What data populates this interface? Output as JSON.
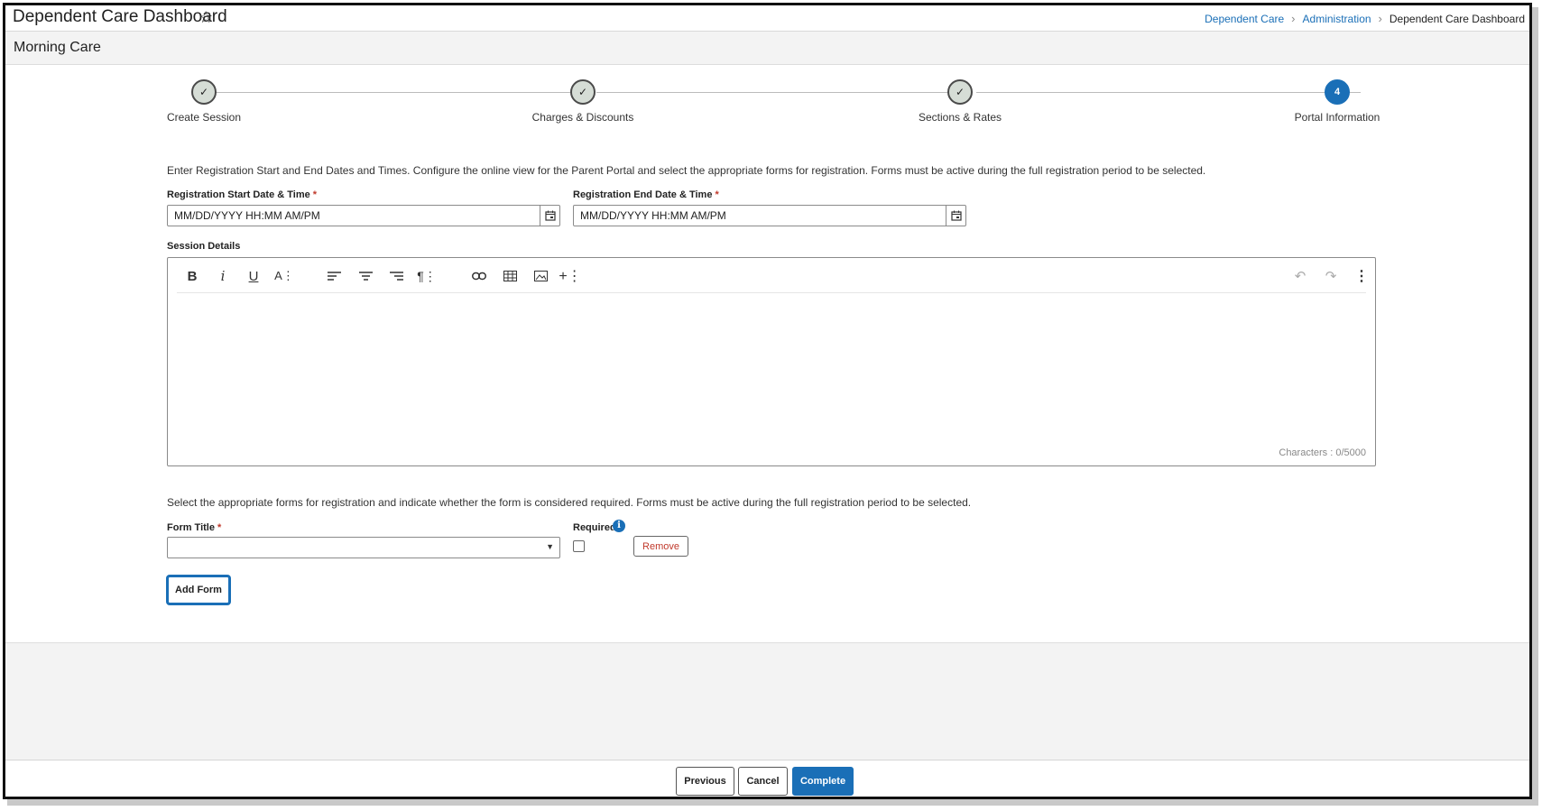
{
  "header": {
    "title": "Dependent Care Dashboard",
    "breadcrumb": [
      "Dependent Care",
      "Administration",
      "Dependent Care Dashboard"
    ]
  },
  "subheader": {
    "title": "Morning Care"
  },
  "stepper": {
    "steps": [
      {
        "label": "Create Session",
        "state": "done"
      },
      {
        "label": "Charges & Discounts",
        "state": "done"
      },
      {
        "label": "Sections & Rates",
        "state": "done"
      },
      {
        "label": "Portal Information",
        "state": "active",
        "number": "4"
      }
    ]
  },
  "form": {
    "intro": "Enter Registration Start and End Dates and Times. Configure the online view for the Parent Portal and select the appropriate forms for registration. Forms must be active during the full registration period to be selected.",
    "start_label": "Registration Start Date & Time",
    "start_placeholder": "MM/DD/YYYY HH:MM AM/PM",
    "end_label": "Registration End Date & Time",
    "end_placeholder": "MM/DD/YYYY HH:MM AM/PM",
    "required_mark": "*",
    "session_details_label": "Session Details",
    "char_count": "Characters : 0/5000",
    "forms_intro": "Select the appropriate forms for registration and indicate whether the form is considered required. Forms must be active during the full registration period to be selected.",
    "form_title_label": "Form Title",
    "form_title_value": "",
    "required_label": "Required",
    "required_checked": false,
    "remove_label": "Remove",
    "add_form_label": "Add Form"
  },
  "footer": {
    "previous_label": "Previous",
    "cancel_label": "Cancel",
    "complete_label": "Complete"
  },
  "colors": {
    "accent": "#1a6fb7",
    "danger": "#c0392b"
  }
}
